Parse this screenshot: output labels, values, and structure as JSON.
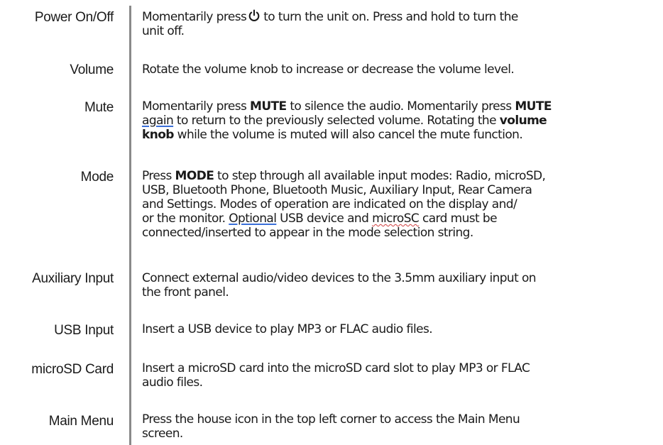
{
  "rows": [
    {
      "label": "Power On/Off",
      "lines": [
        {
          "pre": "Momentarily press",
          "icon": "power-icon",
          "post": "to turn the unit on. Press and hold to turn the"
        },
        {
          "text": "unit off."
        }
      ]
    },
    {
      "label": "Volume",
      "lines": [
        {
          "text": "Rotate the volume knob to increase or decrease the volume level."
        }
      ]
    },
    {
      "label": "Mute",
      "lines": [
        {
          "pre": "Momentarily press ",
          "bold1": "MUTE",
          "mid": " to silence the audio. Momentarily press ",
          "bold2": "MUTE"
        },
        {
          "marked": "again",
          "post": " to return to the previously selected volume. Rotating the ",
          "bold": "volume"
        },
        {
          "bold": "knob",
          "post": " while the volume is muted will also cancel the mute function."
        }
      ]
    },
    {
      "label": "Mode",
      "lines": [
        {
          "pre": "Press ",
          "bold": "MODE",
          "post": " to step through all available input modes: Radio, microSD,"
        },
        {
          "text": "USB, Bluetooth Phone, Bluetooth Music, Auxiliary Input, Rear Camera"
        },
        {
          "text": "and Settings. Modes of operation are indicated on the display and/"
        },
        {
          "pre": "or the monitor. ",
          "marked1": "Optional",
          "mid": " USB device and ",
          "marked2": "microSC",
          "post": " card must be"
        },
        {
          "text": "connected/inserted to appear in the mode selection string."
        }
      ]
    },
    {
      "label": "Auxiliary Input",
      "lines": [
        {
          "text": "Connect external audio/video devices to the 3.5mm auxiliary input on"
        },
        {
          "text": "the front panel."
        }
      ]
    },
    {
      "label": "USB Input",
      "lines": [
        {
          "text": "Insert a USB device to play MP3 or FLAC audio files."
        }
      ]
    },
    {
      "label": "microSD Card",
      "lines": [
        {
          "text": "Insert a microSD card into the microSD card slot to play MP3 or FLAC"
        },
        {
          "text": "audio files."
        }
      ]
    },
    {
      "label": "Main Menu",
      "lines": [
        {
          "text": "Press the house icon in the top left corner to access the Main Menu"
        },
        {
          "text": "screen."
        }
      ]
    }
  ]
}
